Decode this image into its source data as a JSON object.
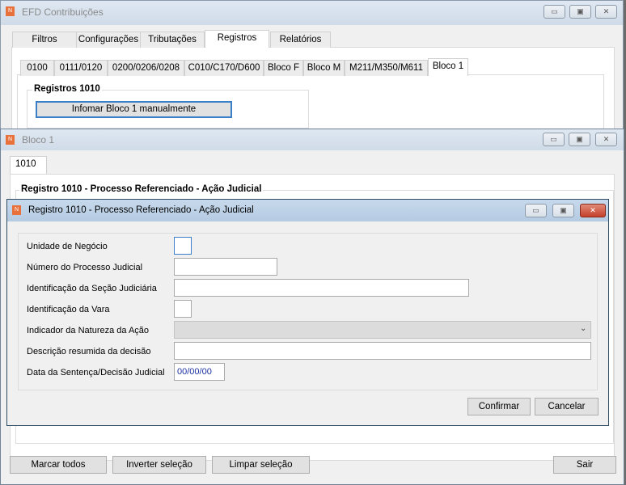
{
  "main_window": {
    "title": "EFD Contribuições",
    "tabs": [
      "Filtros",
      "Configurações",
      "Tributações",
      "Registros",
      "Relatórios"
    ],
    "subtabs": [
      "0100",
      "0111/0120",
      "0200/0206/0208",
      "C010/C170/D600",
      "Bloco F",
      "Bloco M",
      "M211/M350/M611",
      "Bloco 1"
    ],
    "group_title": "Registros 1010",
    "manual_button": "Infomar Bloco 1 manualmente"
  },
  "bloco_window": {
    "title": "Bloco 1",
    "tab": "1010",
    "group_title": "Registro 1010 - Processo Referenciado - Ação Judicial",
    "buttons": {
      "mark_all": "Marcar todos",
      "invert": "Inverter seleção",
      "clear": "Limpar seleção",
      "exit": "Sair"
    }
  },
  "dialog": {
    "title": "Registro 1010 - Processo Referenciado - Ação Judicial",
    "fields": {
      "unidade": {
        "label": "Unidade de Negócio",
        "value": ""
      },
      "numero": {
        "label": "Número do Processo Judicial",
        "value": ""
      },
      "secao": {
        "label": "Identificação da Seção Judiciária",
        "value": ""
      },
      "vara": {
        "label": "Identificação da Vara",
        "value": ""
      },
      "natureza": {
        "label": "Indicador da Natureza da Ação",
        "value": ""
      },
      "descricao": {
        "label": "Descrição resumida da decisão",
        "value": ""
      },
      "data": {
        "label": "Data da Sentença/Decisão Judicial",
        "value": "00/00/00"
      }
    },
    "confirm": "Confirmar",
    "cancel": "Cancelar"
  },
  "window_controls": {
    "minimize": "▭",
    "maximize": "▣",
    "close": "✕"
  }
}
